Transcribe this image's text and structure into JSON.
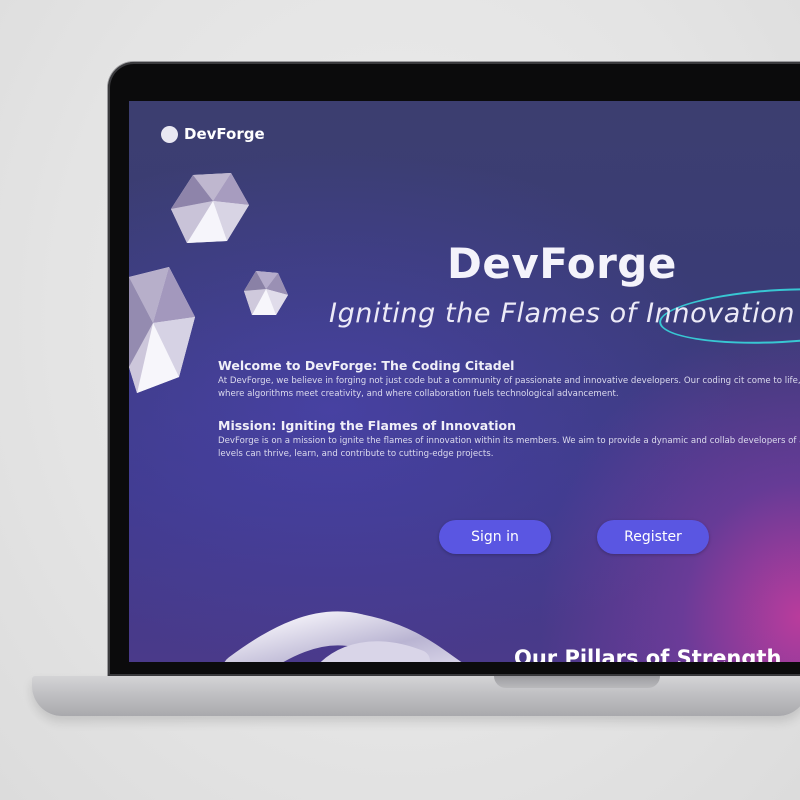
{
  "site": {
    "logo_text": "DevForge",
    "hero_title": "DevForge",
    "hero_subtitle": "Igniting the Flames of Innovation",
    "sections": [
      {
        "heading": "Welcome to DevForge: The Coding Citadel",
        "body": "At DevForge, we believe in forging not just code but a community of passionate and innovative developers. Our coding cit come to life, where algorithms meet creativity, and where collaboration fuels technological advancement."
      },
      {
        "heading": "Mission: Igniting the Flames of Innovation",
        "body": "DevForge is on a mission to ignite the flames of innovation within its members. We aim to provide a dynamic and collab developers of all levels can thrive, learn, and contribute to cutting-edge projects."
      }
    ],
    "buttons": {
      "signin_label": "Sign in",
      "register_label": "Register"
    },
    "pillars_heading": "Our Pillars of Strength"
  },
  "colors": {
    "accent_button": "#5a56e2",
    "highlight_circle": "#38c7d3",
    "background_primary": "#3a3c76",
    "background_glow": "#cd3ca0"
  },
  "icons": {
    "logo_mark": "circle-logo-icon",
    "decor_1": "polyhedron-gem",
    "decor_2": "torus-knot"
  }
}
